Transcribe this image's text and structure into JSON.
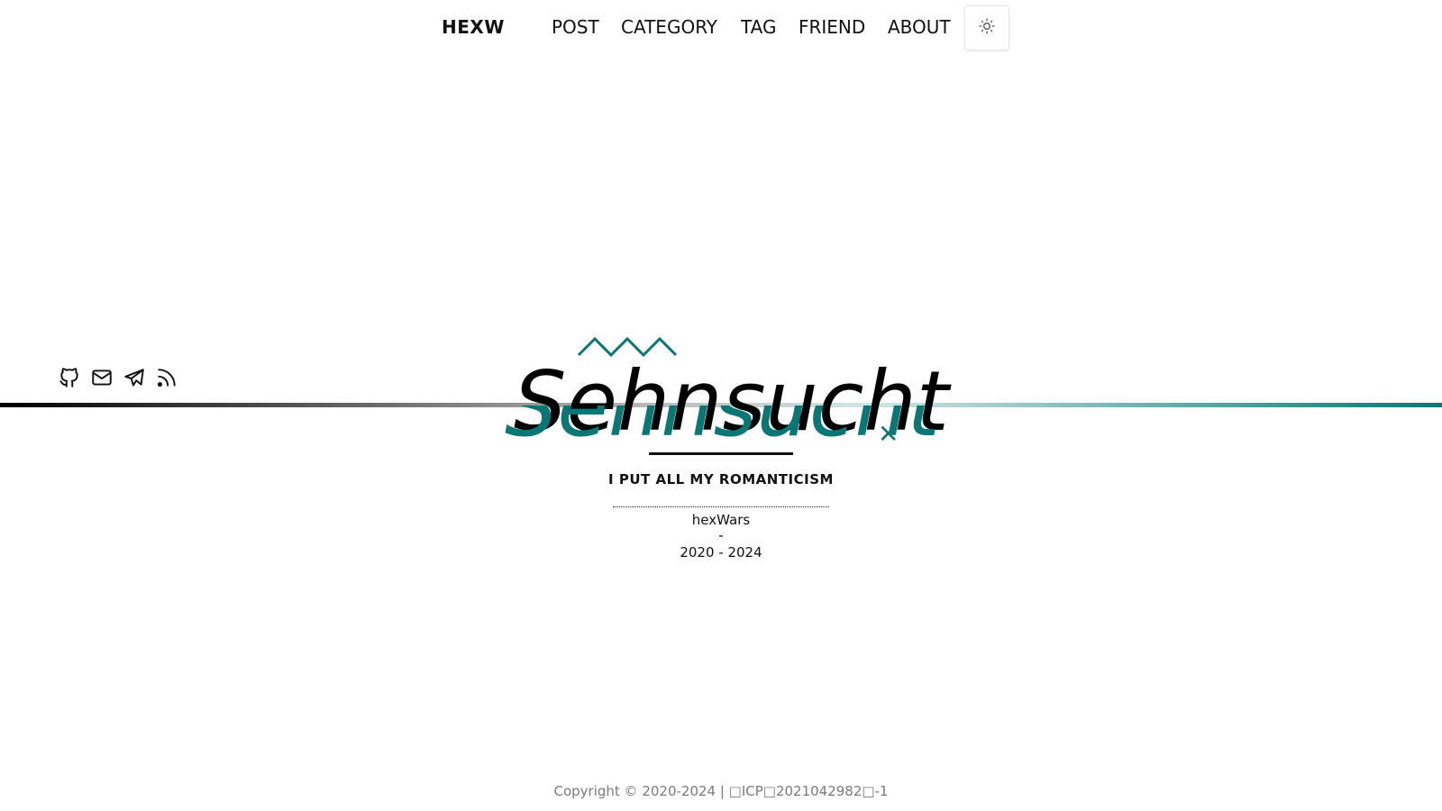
{
  "header": {
    "brand": "HEXW",
    "nav": [
      {
        "label": "POST"
      },
      {
        "label": "CATEGORY"
      },
      {
        "label": "TAG"
      },
      {
        "label": "FRIEND"
      },
      {
        "label": "ABOUT"
      }
    ],
    "theme_toggle_icon": "sun-icon"
  },
  "hero": {
    "title": "Sehnsucht",
    "subtitle": "I PUT ALL MY ROMANTICISM",
    "author": "hexWars",
    "separator": "-",
    "years": "2020 - 2024",
    "social_icons": [
      "github-icon",
      "mail-icon",
      "telegram-icon",
      "rss-icon"
    ]
  },
  "footer": {
    "copyright": "Copyright © 2020-2024 | □ICP□2021042982□-1"
  },
  "colors": {
    "accent": "#0a7777",
    "text": "#111111",
    "footer_text": "#7a7a7a",
    "background": "#ffffff"
  }
}
